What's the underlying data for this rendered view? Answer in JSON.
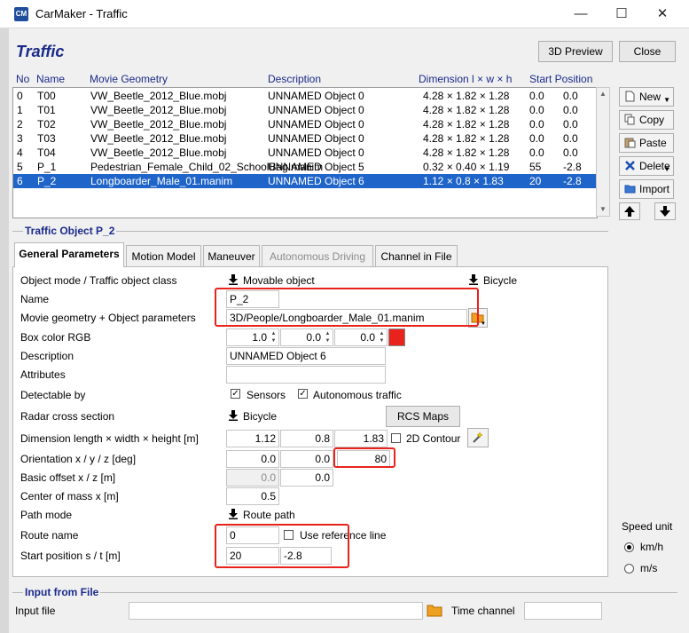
{
  "window": {
    "app_icon_text": "CM",
    "title": "CarMaker - Traffic",
    "minimize": "—",
    "maximize": "☐",
    "close": "✕"
  },
  "header": {
    "title": "Traffic",
    "preview_button": "3D Preview",
    "close_button": "Close"
  },
  "table": {
    "columns": [
      "No",
      "Name",
      "Movie Geometry",
      "Description",
      "Dimension l × w × h",
      "Start Position"
    ],
    "rows": [
      {
        "no": "0",
        "name": "T00",
        "geom": "VW_Beetle_2012_Blue.mobj",
        "desc": "UNNAMED Object 0",
        "dim": "4.28 × 1.82 × 1.28",
        "s": "0.0",
        "t": "0.0"
      },
      {
        "no": "1",
        "name": "T01",
        "geom": "VW_Beetle_2012_Blue.mobj",
        "desc": "UNNAMED Object 0",
        "dim": "4.28 × 1.82 × 1.28",
        "s": "0.0",
        "t": "0.0"
      },
      {
        "no": "2",
        "name": "T02",
        "geom": "VW_Beetle_2012_Blue.mobj",
        "desc": "UNNAMED Object 0",
        "dim": "4.28 × 1.82 × 1.28",
        "s": "0.0",
        "t": "0.0"
      },
      {
        "no": "3",
        "name": "T03",
        "geom": "VW_Beetle_2012_Blue.mobj",
        "desc": "UNNAMED Object 0",
        "dim": "4.28 × 1.82 × 1.28",
        "s": "0.0",
        "t": "0.0"
      },
      {
        "no": "4",
        "name": "T04",
        "geom": "VW_Beetle_2012_Blue.mobj",
        "desc": "UNNAMED Object 0",
        "dim": "4.28 × 1.82 × 1.28",
        "s": "0.0",
        "t": "0.0"
      },
      {
        "no": "5",
        "name": "P_1",
        "geom": "Pedestrian_Female_Child_02_SchoolBag.manim",
        "desc": "UNNAMED Object 5",
        "dim": "0.32 × 0.40 × 1.19",
        "s": "55",
        "t": "-2.8"
      },
      {
        "no": "6",
        "name": "P_2",
        "geom": "Longboarder_Male_01.manim",
        "desc": "UNNAMED Object 6",
        "dim": "1.12 × 0.8 × 1.83",
        "s": "20",
        "t": "-2.8"
      }
    ],
    "selected_index": 6
  },
  "side_buttons": {
    "new": "New",
    "copy": "Copy",
    "paste": "Paste",
    "delete": "Delete",
    "import": "Import"
  },
  "traffic_object": {
    "group_title": "Traffic Object P_2",
    "tabs": [
      "General Parameters",
      "Motion Model",
      "Maneuver",
      "Autonomous Driving",
      "Channel in File"
    ],
    "active_tab": "General Parameters",
    "disabled_tab": "Autonomous Driving",
    "labels": {
      "object_mode": "Object mode / Traffic object class",
      "name": "Name",
      "movie_geometry": "Movie geometry + Object parameters",
      "box_color": "Box color RGB",
      "description": "Description",
      "attributes": "Attributes",
      "detectable_by": "Detectable by",
      "radar": "Radar cross section",
      "dimension": "Dimension length × width × height [m]",
      "orientation": "Orientation x / y / z [deg]",
      "basic_offset": "Basic offset x / z [m]",
      "center_mass": "Center of mass x [m]",
      "path_mode": "Path mode",
      "route_name": "Route name",
      "start_position": "Start position s / t [m]"
    },
    "values": {
      "object_mode": "Movable object",
      "object_class": "Bicycle",
      "name": "P_2",
      "movie_geometry": "3D/People/Longboarder_Male_01.manim",
      "color_r": "1.0",
      "color_g": "0.0",
      "color_b": "0.0",
      "color_swatch": "#e8231c",
      "description": "UNNAMED Object 6",
      "attributes": "",
      "sensors": "Sensors",
      "autonomous_traffic": "Autonomous traffic",
      "radar": "Bicycle",
      "rcs_maps": "RCS Maps",
      "dim_l": "1.12",
      "dim_w": "0.8",
      "dim_h": "1.83",
      "contour_2d": "2D Contour",
      "orient_x": "0.0",
      "orient_y": "0.0",
      "orient_z": "80",
      "offset_x": "0.0",
      "offset_z": "0.0",
      "center_mass": "0.5",
      "path_mode": "Route path",
      "route_name": "0",
      "use_reference_line": "Use reference line",
      "start_s": "20",
      "start_t": "-2.8"
    }
  },
  "speed_unit": {
    "title": "Speed unit",
    "options": [
      "km/h",
      "m/s"
    ],
    "selected": "km/h"
  },
  "input_from_file": {
    "group_title": "Input from File",
    "input_label": "Input file",
    "input_value": "",
    "time_channel_label": "Time channel",
    "time_channel_value": ""
  }
}
